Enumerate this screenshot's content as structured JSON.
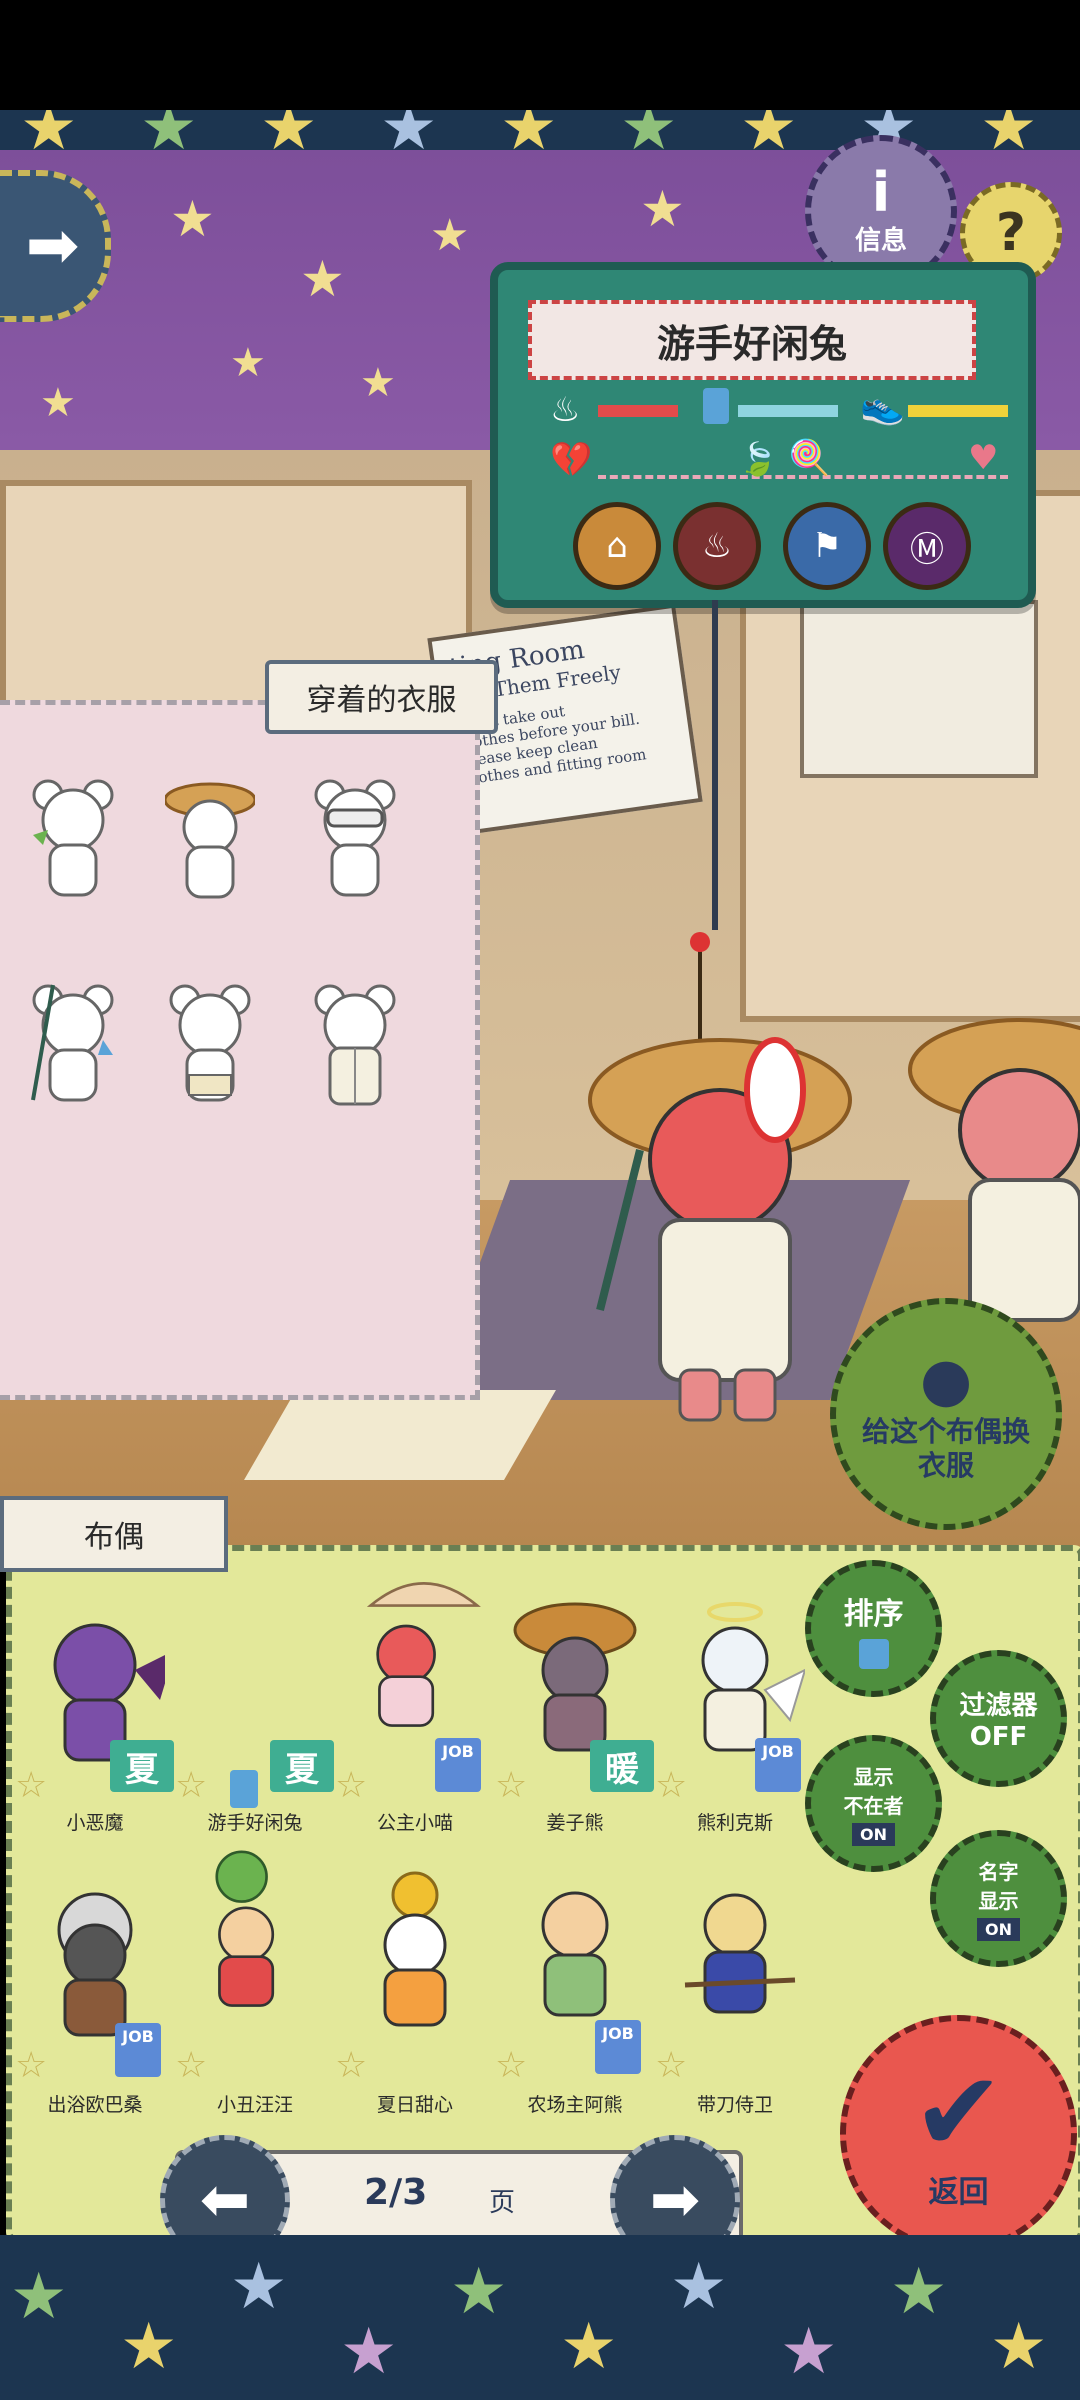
{
  "info_panel": {
    "doll_name": "游手好闲兔",
    "info_button_label": "信息",
    "help_button_label": "?"
  },
  "clothes_panel": {
    "title": "穿着的衣服"
  },
  "fitting_sign": {
    "line1": "ting Room",
    "line2": "Try Them Freely",
    "line3": "Don't take out",
    "line4": "clothes before your bill.",
    "line5": "Please keep clean",
    "line6": "clothes and fitting room"
  },
  "change_clothes_button": {
    "label": "给这个布偶换衣服"
  },
  "doll_panel": {
    "tab_label": "布偶",
    "dolls": [
      {
        "name": "小恶魔",
        "tag": "夏",
        "job": false
      },
      {
        "name": "游手好闲兔",
        "tag": "夏",
        "job": false
      },
      {
        "name": "公主小喵",
        "tag": "",
        "job": true
      },
      {
        "name": "姜子熊",
        "tag": "暖",
        "job": false
      },
      {
        "name": "熊利克斯",
        "tag": "",
        "job": true
      },
      {
        "name": "出浴欧巴桑",
        "tag": "",
        "job": true
      },
      {
        "name": "小丑汪汪",
        "tag": "",
        "job": false
      },
      {
        "name": "夏日甜心",
        "tag": "",
        "job": false
      },
      {
        "name": "农场主阿熊",
        "tag": "",
        "job": true
      },
      {
        "name": "带刀侍卫",
        "tag": "",
        "job": false
      }
    ],
    "job_label": "JOB"
  },
  "side_buttons": {
    "sort": "排序",
    "filter": "过滤器",
    "filter_state": "OFF",
    "show_absent_line1": "显示",
    "show_absent_line2": "不在者",
    "show_absent_state": "ON",
    "show_name_line1": "名字",
    "show_name_line2": "显示",
    "show_name_state": "ON",
    "return": "返回"
  },
  "pager": {
    "page": "2/3",
    "unit": "页"
  },
  "colors": {
    "panel_green": "#2f8775",
    "doll_panel": "#e3e89a",
    "clothes_panel": "#efd9de",
    "return_red": "#e9574f"
  }
}
